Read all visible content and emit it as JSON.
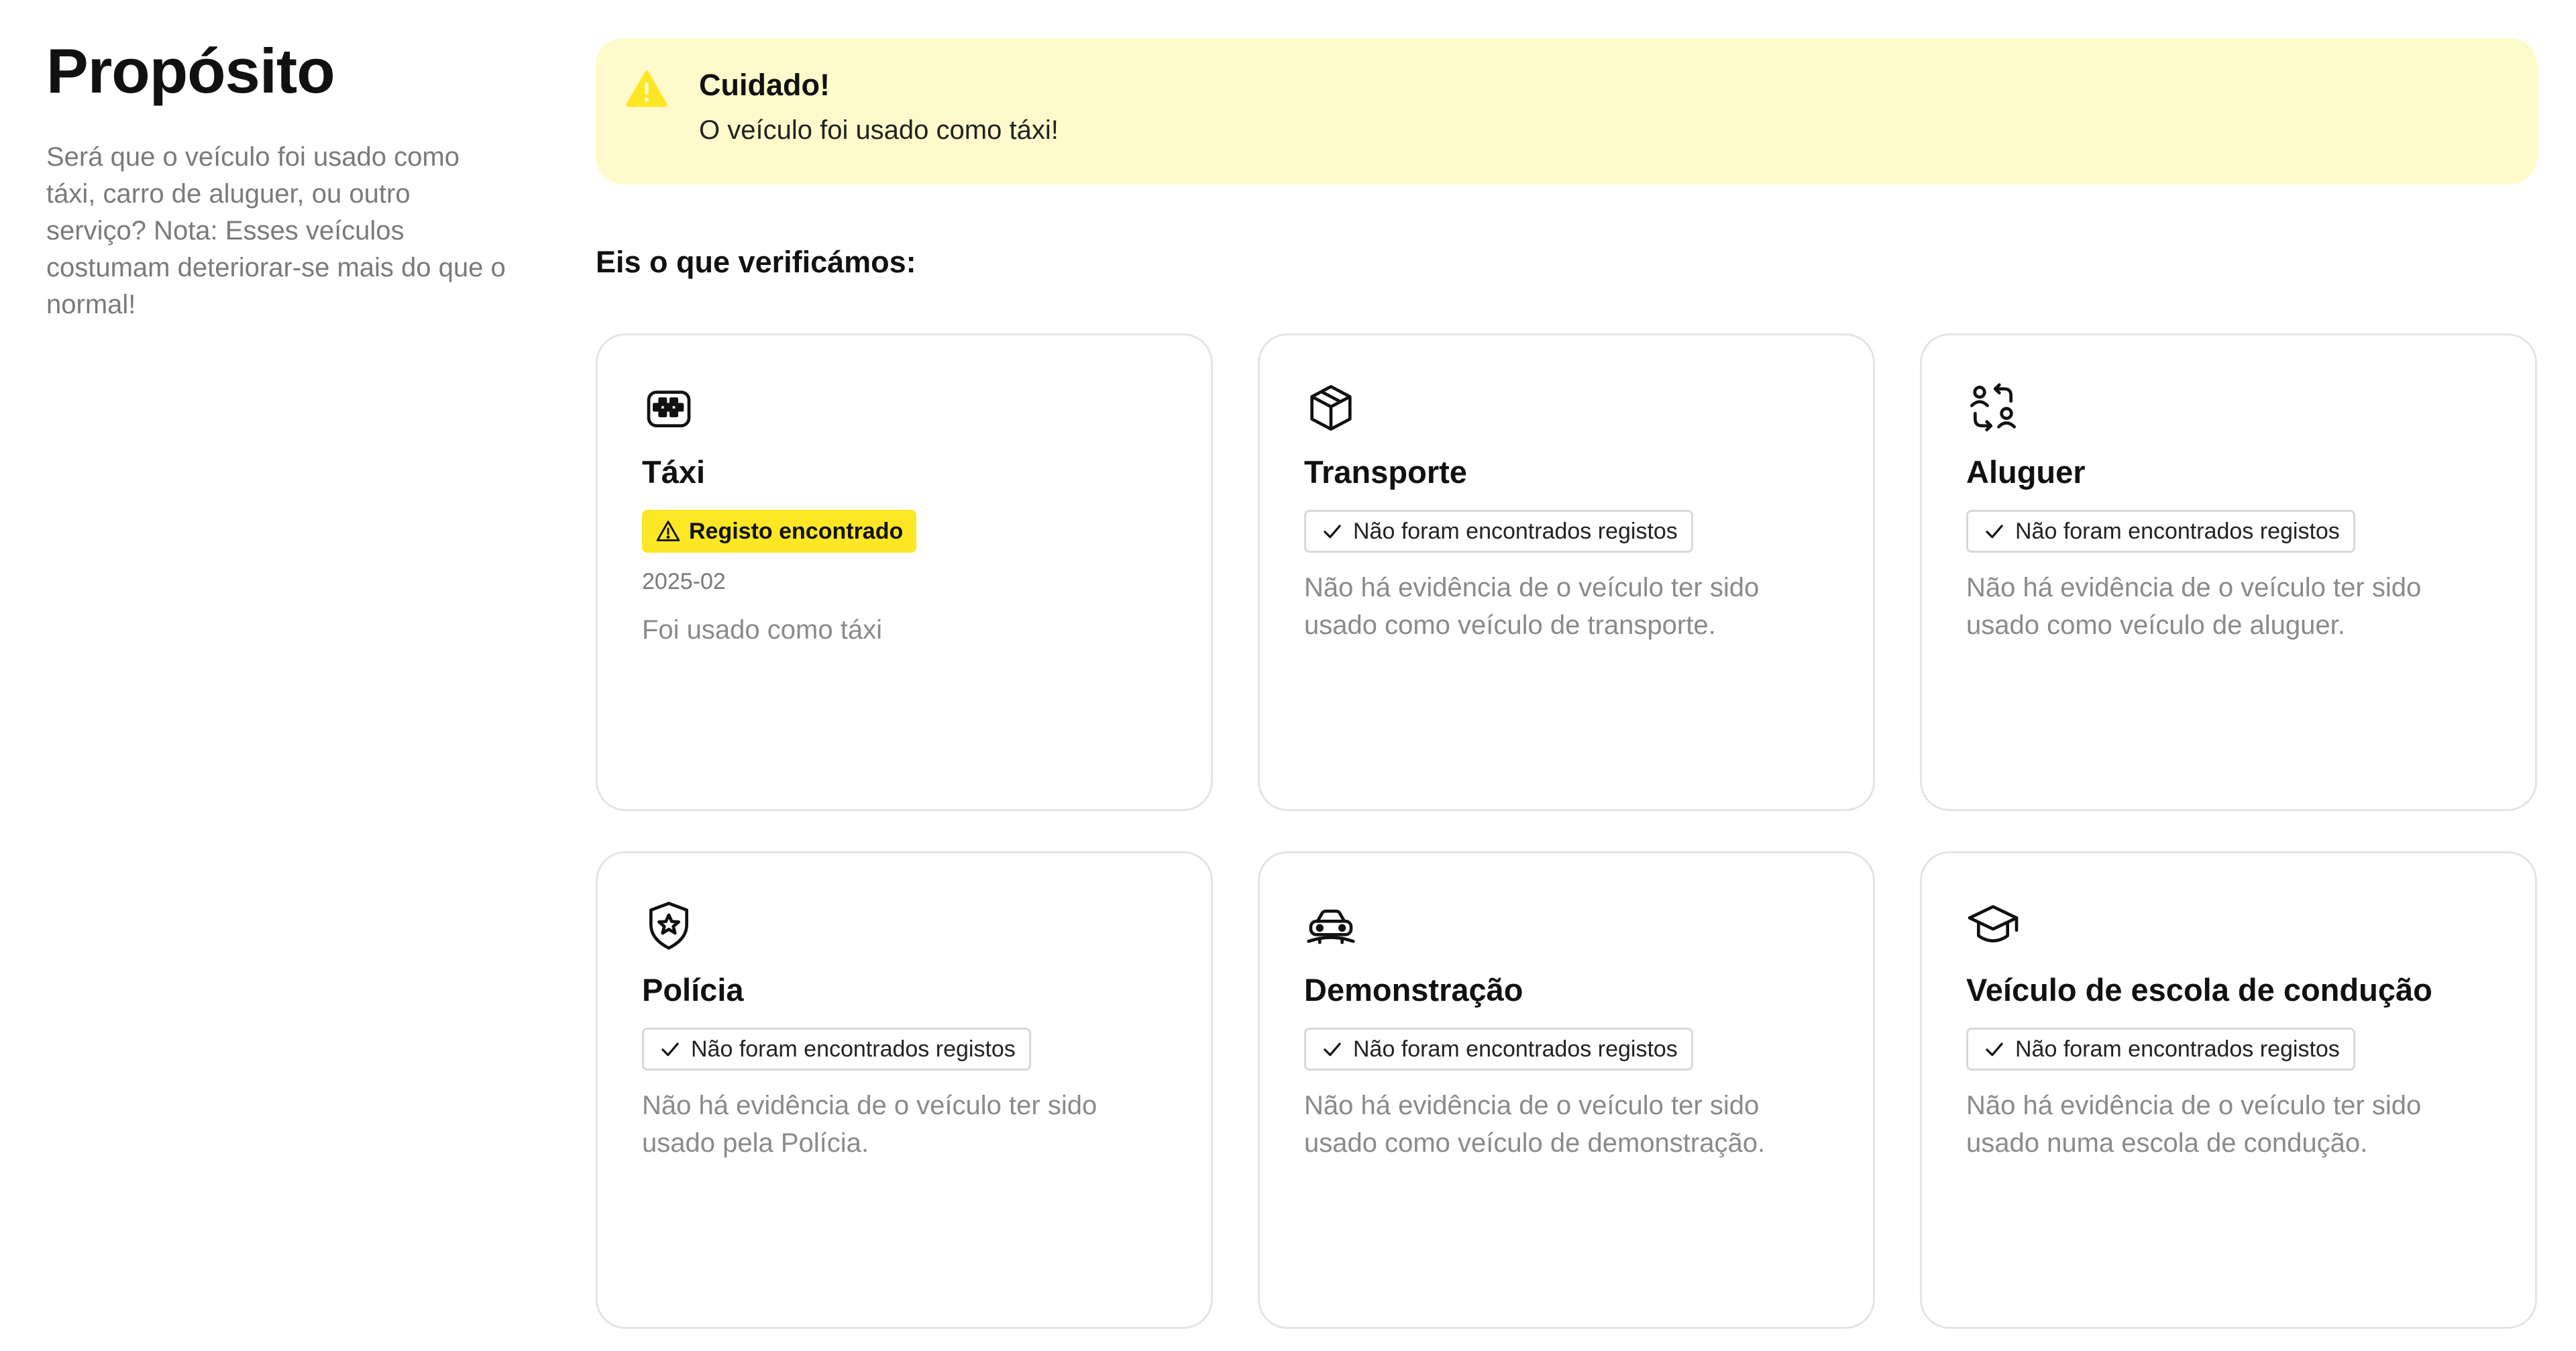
{
  "sidebar": {
    "title": "Propósito",
    "description": "Será que o veículo foi usado como táxi, carro de aluguer, ou outro serviço? Nota: Esses veículos costumam deteriorar-se mais do que o normal!"
  },
  "alert": {
    "icon": "warning-icon",
    "title": "Cuidado!",
    "text": "O veículo foi usado como táxi!",
    "background": "#fefacb",
    "icon_color": "#fde725"
  },
  "section": {
    "heading": "Eis o que verificámos:"
  },
  "cards": [
    {
      "icon": "taxi-icon",
      "title": "Táxi",
      "status": "found",
      "badge": "Registo encontrado",
      "date": "2025-02",
      "description": "Foi usado como táxi"
    },
    {
      "icon": "box-icon",
      "title": "Transporte",
      "status": "none",
      "badge": "Não foram encontrados registos",
      "description": "Não há evidência de o veículo ter sido usado como veículo de transporte."
    },
    {
      "icon": "rental-swap-icon",
      "title": "Aluguer",
      "status": "none",
      "badge": "Não foram encontrados registos",
      "description": "Não há evidência de o veículo ter sido usado como veículo de aluguer."
    },
    {
      "icon": "police-shield-icon",
      "title": "Polícia",
      "status": "none",
      "badge": "Não foram encontrados registos",
      "description": "Não há evidência de o veículo ter sido usado pela Polícia."
    },
    {
      "icon": "demo-car-icon",
      "title": "Demonstração",
      "status": "none",
      "badge": "Não foram encontrados registos",
      "description": "Não há evidência de o veículo ter sido usado como veículo de demonstração."
    },
    {
      "icon": "graduation-cap-icon",
      "title": "Veículo de escola de condução",
      "status": "none",
      "badge": "Não foram encontrados registos",
      "description": "Não há evidência de o veículo ter sido usado numa escola de condução."
    }
  ],
  "colors": {
    "found_badge": "#fde725",
    "card_border": "#e4e4e4",
    "muted_text": "#8a8a8a"
  }
}
